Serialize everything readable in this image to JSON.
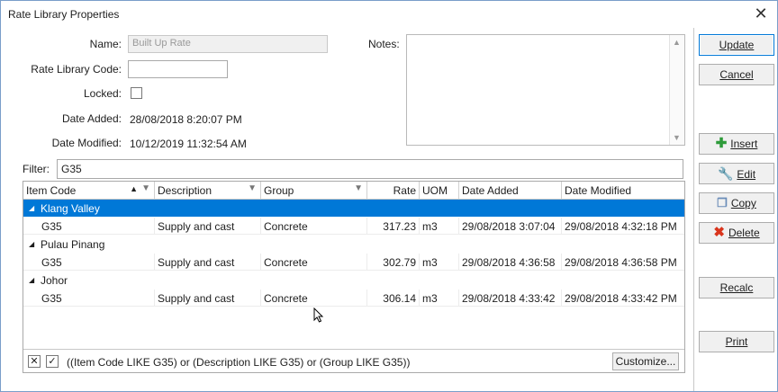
{
  "window": {
    "title": "Rate Library Properties",
    "close_glyph": "✕"
  },
  "form": {
    "name_label": "Name:",
    "name_value": "Built Up Rate",
    "code_label": "Rate Library Code:",
    "code_value": "",
    "locked_label": "Locked:",
    "date_added_label": "Date Added:",
    "date_added_value": "28/08/2018 8:20:07 PM",
    "date_modified_label": "Date Modified:",
    "date_modified_value": "10/12/2019 11:32:54 AM",
    "notes_label": "Notes:"
  },
  "filter": {
    "label": "Filter:",
    "value": "G35"
  },
  "grid": {
    "columns": [
      "Item Code",
      "Description",
      "Group",
      "Rate",
      "UOM",
      "Date Added",
      "Date Modified"
    ],
    "groups": [
      {
        "name": "Klang Valley",
        "rows": [
          [
            "G35",
            "Supply and cast",
            "Concrete",
            "317.23",
            "m3",
            "29/08/2018 3:07:04",
            "29/08/2018 4:32:18 PM"
          ]
        ]
      },
      {
        "name": "Pulau Pinang",
        "rows": [
          [
            "G35",
            "Supply and cast",
            "Concrete",
            "302.79",
            "m3",
            "29/08/2018 4:36:58",
            "29/08/2018 4:36:58 PM"
          ]
        ]
      },
      {
        "name": "Johor",
        "rows": [
          [
            "G35",
            "Supply and cast",
            "Concrete",
            "306.14",
            "m3",
            "29/08/2018 4:33:42",
            "29/08/2018 4:33:42 PM"
          ]
        ]
      }
    ],
    "footer_filter_text": "((Item Code LIKE G35) or (Description LIKE G35) or (Group LIKE G35))",
    "customize_label": "Customize..."
  },
  "buttons": {
    "update": "Update",
    "cancel": "Cancel",
    "insert": "Insert",
    "edit": "Edit",
    "copy": "Copy",
    "delete": "Delete",
    "recalc": "Recalc",
    "print": "Print"
  },
  "colors": {
    "selection": "#0078d7",
    "insert_icon": "#2e9b3a",
    "delete_icon": "#d9341c"
  }
}
